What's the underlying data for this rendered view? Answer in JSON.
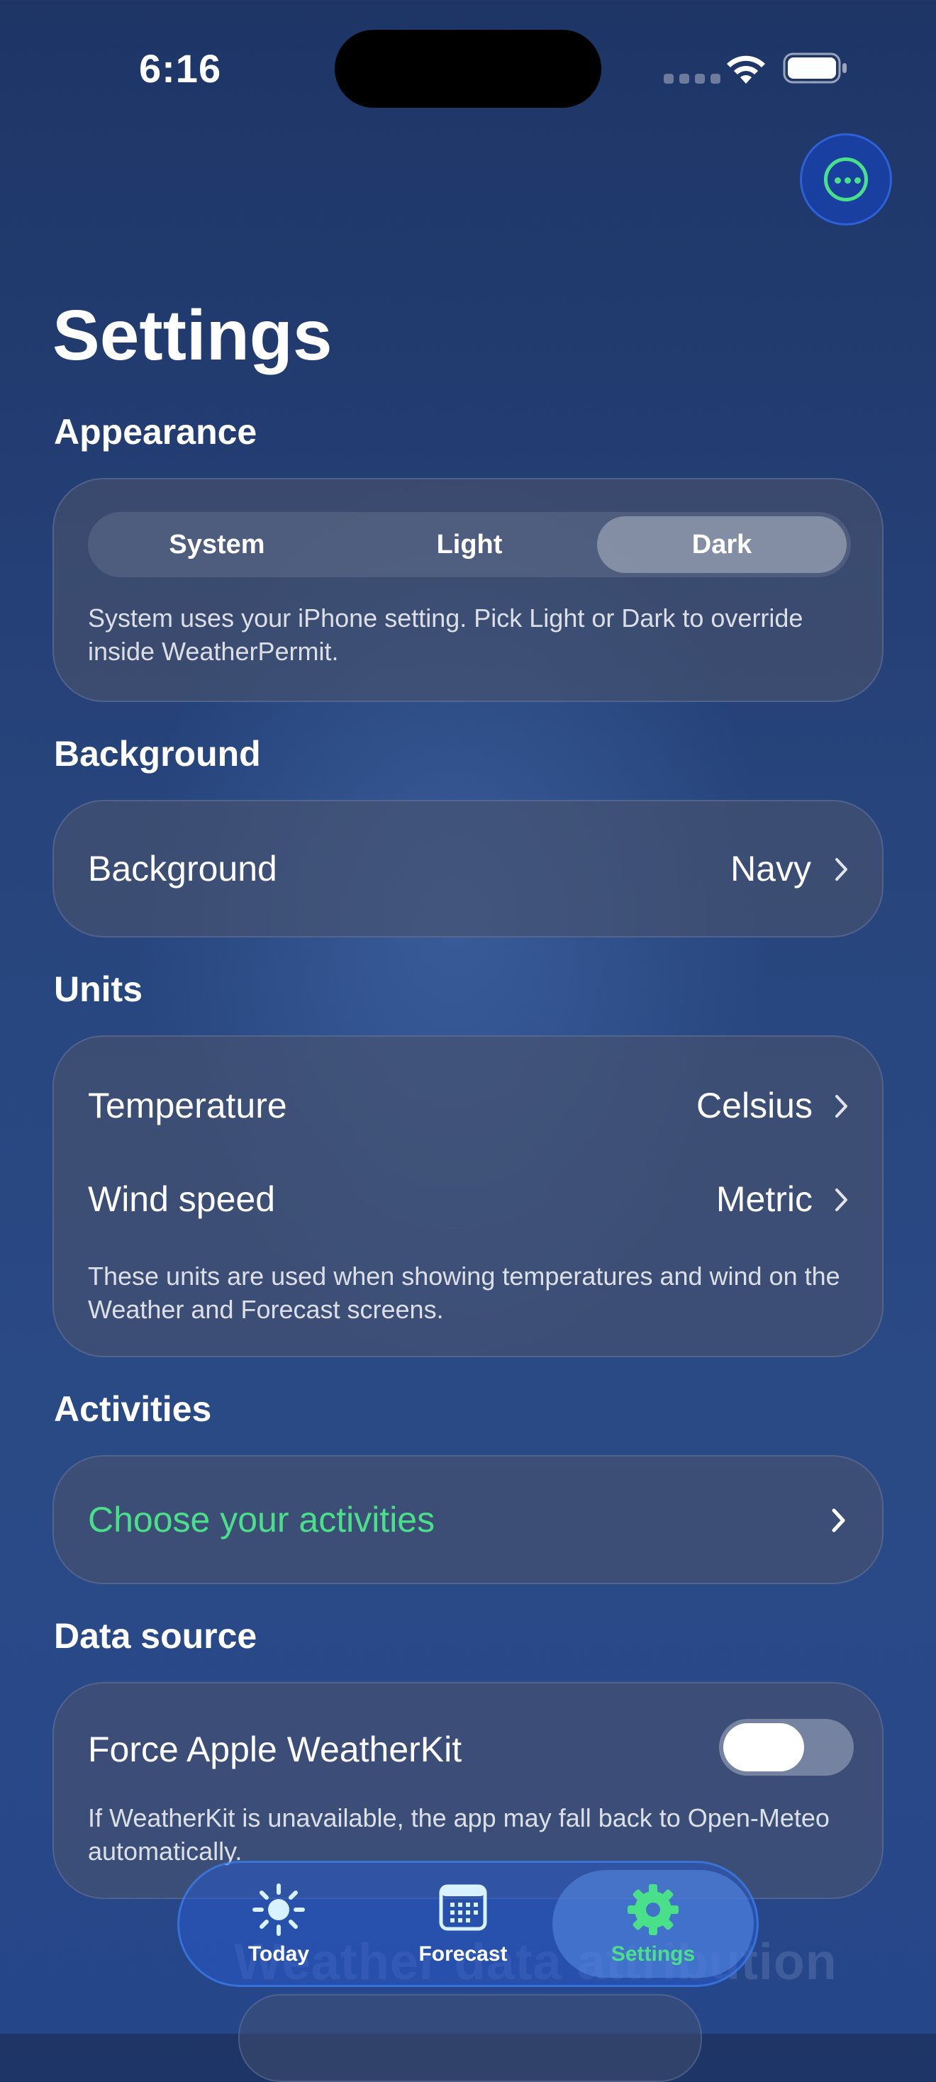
{
  "status_bar": {
    "time": "6:16"
  },
  "header": {
    "title": "Settings",
    "more_icon": "ellipsis-circle-icon",
    "accent": "#4ae08a"
  },
  "appearance": {
    "section_title": "Appearance",
    "segments": [
      "System",
      "Light",
      "Dark"
    ],
    "selected": "Dark",
    "note": "System uses your iPhone setting. Pick Light or Dark to override inside WeatherPermit."
  },
  "background": {
    "section_title": "Background",
    "row_label": "Background",
    "row_value": "Navy"
  },
  "units": {
    "section_title": "Units",
    "temperature_label": "Temperature",
    "temperature_value": "Celsius",
    "wind_label": "Wind speed",
    "wind_value": "Metric",
    "note": "These units are used when showing temperatures and wind on the Weather and Forecast screens."
  },
  "activities": {
    "section_title": "Activities",
    "row_label": "Choose your activities",
    "row_color": "#4ae08a"
  },
  "data_source": {
    "section_title": "Data source",
    "toggle_label": "Force Apple WeatherKit",
    "toggle_on": false,
    "note": "If WeatherKit is unavailable, the app may fall back to Open-Meteo automatically.",
    "next_section_title": "Weather data attribution"
  },
  "tab_bar": {
    "tabs": [
      {
        "label": "Today",
        "icon": "sun-icon"
      },
      {
        "label": "Forecast",
        "icon": "calendar-icon"
      },
      {
        "label": "Settings",
        "icon": "gear-icon"
      }
    ],
    "selected": "Settings",
    "selected_color": "#4ae08a"
  }
}
